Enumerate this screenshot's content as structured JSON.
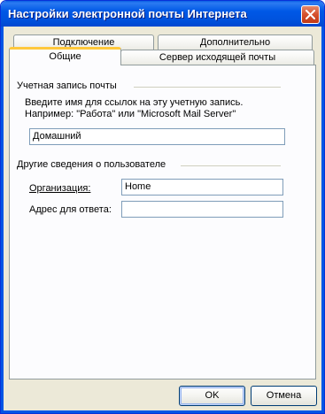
{
  "window": {
    "title": "Настройки электронной почты Интернета"
  },
  "tabs": {
    "row1": [
      {
        "label": "Подключение"
      },
      {
        "label": "Дополнительно"
      }
    ],
    "row2": [
      {
        "label": "Общие",
        "active": true
      },
      {
        "label": "Сервер исходящей почты"
      }
    ]
  },
  "general": {
    "mail_account": {
      "group_label": "Учетная запись почты",
      "description_line1": "Введите имя для ссылок на эту учетную запись.",
      "description_line2": "Например: \"Работа\" или \"Microsoft Mail Server\"",
      "account_name_value": "Домашний"
    },
    "user_info": {
      "group_label": "Другие сведения о пользователе",
      "organization_label": "Организация:",
      "organization_value": "Home",
      "reply_to_label": "Адрес для ответа:",
      "reply_to_value": ""
    }
  },
  "buttons": {
    "ok": "OK",
    "cancel": "Отмена"
  },
  "colors": {
    "titlebar": "#0058E6",
    "dialog_bg": "#ECE9D8",
    "active_tab_accent": "#FFC83C",
    "close_button": "#D5502D"
  },
  "icons": {
    "close": "close-icon"
  }
}
